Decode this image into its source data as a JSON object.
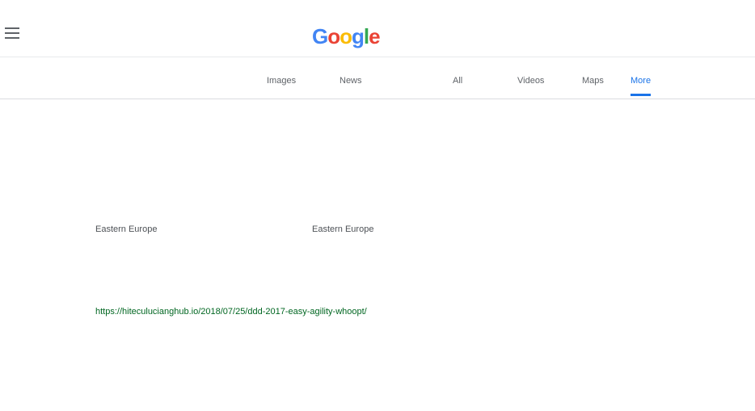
{
  "header": {
    "logo_letters": [
      "G",
      "o",
      "o",
      "g",
      "l",
      "e"
    ],
    "search_value": "",
    "menu_icon": "menu-icon"
  },
  "tabs": [
    {
      "label": "All",
      "active": true
    },
    {
      "label": "Images",
      "active": false
    },
    {
      "label": "News",
      "active": false
    },
    {
      "label": "Videos",
      "active": false
    },
    {
      "label": "Maps",
      "active": false
    },
    {
      "label": "More",
      "active": false
    }
  ],
  "results": [
    {
      "columns": [
        {
          "title": "",
          "url": "",
          "snippet": "",
          "region": ""
        },
        {
          "title": "",
          "url": "",
          "snippet": "",
          "region": ""
        },
        {
          "title": "",
          "url": "",
          "snippet": "",
          "region": ""
        }
      ]
    },
    {
      "columns": [
        {
          "title": "",
          "url": "",
          "snippet": "",
          "region": "Eastern Europe"
        },
        {
          "title": "",
          "url": "",
          "snippet": "",
          "region": "Eastern Europe"
        },
        {
          "title": "",
          "url": "",
          "snippet": "",
          "region": ""
        }
      ]
    },
    {
      "columns": [
        {
          "title": "",
          "url": "https://hiteculucianghub.io/2018/07/25/ddd-2017-easy-agility-whoopt/",
          "snippet": "",
          "region": ""
        },
        {
          "title": "",
          "url": "",
          "snippet": "",
          "region": ""
        },
        {
          "title": "",
          "url": "",
          "snippet": "",
          "region": ""
        }
      ]
    },
    {
      "columns": [
        {
          "title": "",
          "url": "",
          "snippet": "",
          "region": ""
        },
        {
          "title": "",
          "url": "",
          "snippet": "",
          "region": ""
        },
        {
          "title": "",
          "url": "",
          "snippet": "",
          "region": ""
        }
      ]
    }
  ],
  "colors": {
    "visited": "#660099",
    "link": "#1a0dab",
    "url_green": "#006621",
    "tab_active": "#1a73e8"
  }
}
